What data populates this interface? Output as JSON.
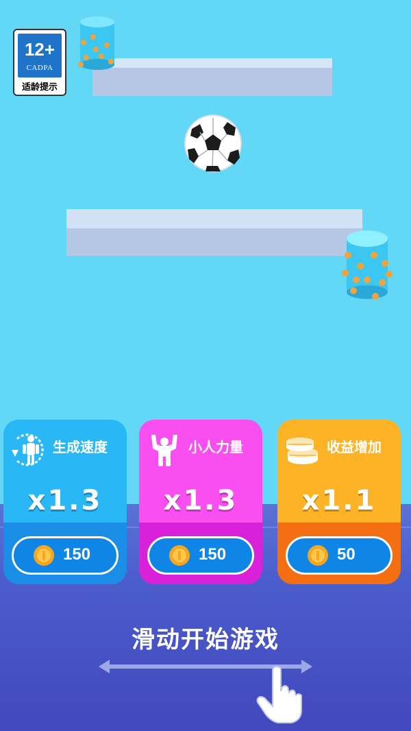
{
  "age_rating": {
    "age": "12+",
    "org": "CADPA",
    "tip": "适龄提示"
  },
  "upgrades": [
    {
      "title": "生成速度",
      "multiplier": "x1.3",
      "cost": "150",
      "icon": "running-man-icon"
    },
    {
      "title": "小人力量",
      "multiplier": "x1.3",
      "cost": "150",
      "icon": "strong-man-icon"
    },
    {
      "title": "收益增加",
      "multiplier": "x1.1",
      "cost": "50",
      "icon": "coin-stack-icon"
    }
  ],
  "start_prompt": "滑动开始游戏",
  "colors": {
    "sky": "#63d8f6",
    "floor": "#4b5ccb",
    "card_speed": "#29b8f5",
    "card_power": "#f94ff0",
    "card_income": "#fdb326",
    "cost_pill": "#0f86e6",
    "coin": "#f5a623"
  }
}
